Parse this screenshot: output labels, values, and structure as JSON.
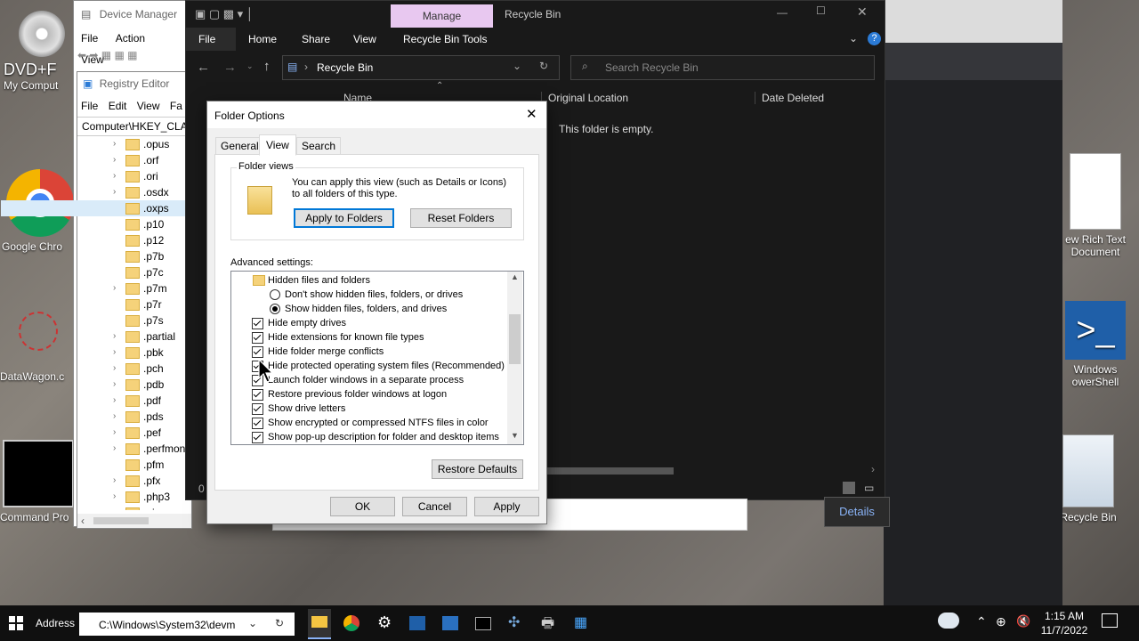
{
  "desktop": {
    "icons": [
      {
        "label": "DVD+F",
        "sub": "My Comput"
      },
      {
        "label": "Google Chro"
      },
      {
        "label": "DataWagon.c"
      },
      {
        "label": "Command Pro"
      },
      {
        "label": "ew Rich Text\nDocument"
      },
      {
        "label": "Windows\nowerShell"
      },
      {
        "label": "Recycle Bin"
      }
    ]
  },
  "device_manager": {
    "title": "Device Manager",
    "menu": [
      "File",
      "Action",
      "View"
    ]
  },
  "registry_editor": {
    "title": "Registry Editor",
    "menu": [
      "File",
      "Edit",
      "View",
      "Fa"
    ],
    "address": "Computer\\HKEY_CLAS",
    "tree": [
      ".opus",
      ".orf",
      ".ori",
      ".osdx",
      ".oxps",
      ".p10",
      ".p12",
      ".p7b",
      ".p7c",
      ".p7m",
      ".p7r",
      ".p7s",
      ".partial",
      ".pbk",
      ".pch",
      ".pdb",
      ".pdf",
      ".pds",
      ".pef",
      ".perfmon",
      ".pfm",
      ".pfx",
      ".php3",
      ".pic"
    ]
  },
  "explorer": {
    "context_tab": "Manage",
    "title": "Recycle Bin",
    "tabs": [
      "File",
      "Home",
      "Share",
      "View",
      "Recycle Bin Tools"
    ],
    "path": "Recycle Bin",
    "search_placeholder": "Search Recycle Bin",
    "columns": [
      "Name",
      "Original Location",
      "Date Deleted"
    ],
    "empty_text": "This folder is empty.",
    "status_count": "0",
    "details_button": "Details"
  },
  "folder_options": {
    "title": "Folder Options",
    "tabs": [
      "General",
      "View",
      "Search"
    ],
    "active_tab": "View",
    "folder_views_label": "Folder views",
    "folder_views_desc": "You can apply this view (such as Details or Icons) to all folders of this type.",
    "apply_to_folders": "Apply to Folders",
    "reset_folders": "Reset Folders",
    "advanced_label": "Advanced settings:",
    "advanced_items": [
      {
        "type": "folder",
        "label": "Hidden files and folders"
      },
      {
        "type": "radio",
        "checked": false,
        "label": "Don't show hidden files, folders, or drives"
      },
      {
        "type": "radio",
        "checked": true,
        "label": "Show hidden files, folders, and drives"
      },
      {
        "type": "check",
        "checked": true,
        "label": "Hide empty drives"
      },
      {
        "type": "check",
        "checked": true,
        "label": "Hide extensions for known file types"
      },
      {
        "type": "check",
        "checked": true,
        "label": "Hide folder merge conflicts"
      },
      {
        "type": "check",
        "checked": true,
        "label": "Hide protected operating system files (Recommended)"
      },
      {
        "type": "check",
        "checked": true,
        "label": "Launch folder windows in a separate process"
      },
      {
        "type": "check",
        "checked": true,
        "label": "Restore previous folder windows at logon"
      },
      {
        "type": "check",
        "checked": true,
        "label": "Show drive letters"
      },
      {
        "type": "check",
        "checked": true,
        "label": "Show encrypted or compressed NTFS files in color"
      },
      {
        "type": "check",
        "checked": true,
        "label": "Show pop-up description for folder and desktop items"
      }
    ],
    "restore_defaults": "Restore Defaults",
    "ok": "OK",
    "cancel": "Cancel",
    "apply": "Apply"
  },
  "taskbar": {
    "address_label": "Address",
    "address_value": "C:\\Windows\\System32\\devm",
    "time": "1:15 AM",
    "date": "11/7/2022"
  },
  "colors": {
    "accent": "#0078d7",
    "manage_tab": "#e8c8f0",
    "explorer_bg": "#191919"
  }
}
